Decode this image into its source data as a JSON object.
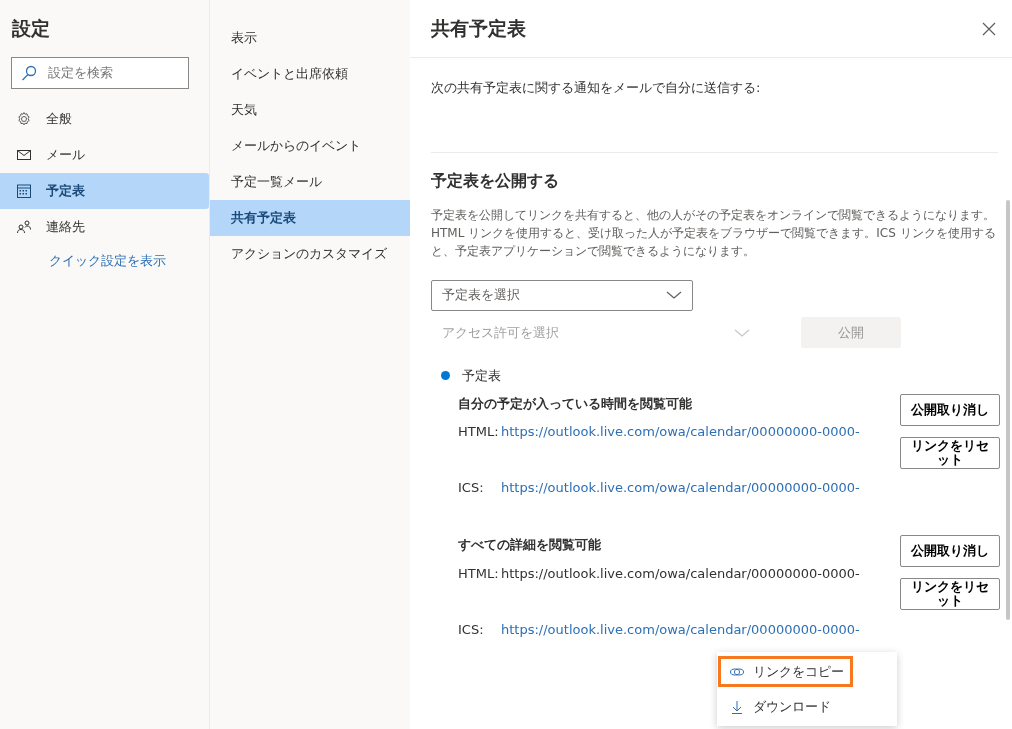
{
  "sidebar": {
    "title": "設定",
    "search": {
      "placeholder": "設定を検索"
    },
    "items": [
      {
        "label": "全般",
        "selected": false
      },
      {
        "label": "メール",
        "selected": false
      },
      {
        "label": "予定表",
        "selected": true
      },
      {
        "label": "連絡先",
        "selected": false
      }
    ],
    "quick_link": "クイック設定を表示"
  },
  "subnav": {
    "items": [
      {
        "label": "表示",
        "selected": false
      },
      {
        "label": "イベントと出席依頼",
        "selected": false
      },
      {
        "label": "天気",
        "selected": false
      },
      {
        "label": "メールからのイベント",
        "selected": false
      },
      {
        "label": "予定一覧メール",
        "selected": false
      },
      {
        "label": "共有予定表",
        "selected": true
      },
      {
        "label": "アクションのカスタマイズ",
        "selected": false
      }
    ]
  },
  "panel": {
    "title": "共有予定表",
    "notify_text": "次の共有予定表に関する通知をメールで自分に送信する:",
    "publish": {
      "heading": "予定表を公開する",
      "description": "予定表を公開してリンクを共有すると、他の人がその予定表をオンラインで閲覧できるようになります。HTML リンクを使用すると、受け取った人が予定表をブラウザーで閲覧できます。ICS リンクを使用すると、予定表アプリケーションで閲覧できるようになります。",
      "calendar_select": {
        "placeholder": "予定表を選択",
        "disabled": false
      },
      "permission_select": {
        "placeholder": "アクセス許可を選択",
        "disabled": true
      },
      "publish_button": {
        "label": "公開",
        "disabled": true
      },
      "calendar": {
        "name": "予定表",
        "color": "#0078d4",
        "permissions": [
          {
            "title": "自分の予定が入っている時間を閲覧可能",
            "buttons": [
              "公開取り消し",
              "リンクをリセット"
            ],
            "links": [
              {
                "label": "HTML:",
                "url": "https://outlook.live.com/owa/calendar/00000000-0000-",
                "visited": false
              },
              {
                "label": "ICS:",
                "url": "https://outlook.live.com/owa/calendar/00000000-0000-",
                "visited": false
              }
            ]
          },
          {
            "title": "すべての詳細を閲覧可能",
            "buttons": [
              "公開取り消し",
              "リンクをリセット"
            ],
            "links": [
              {
                "label": "HTML:",
                "url": "https://outlook.live.com/owa/calendar/00000000-0000-",
                "visited": true
              },
              {
                "label": "ICS:",
                "url": "https://outlook.live.com/owa/calendar/00000000-0000-",
                "visited": false
              }
            ]
          }
        ]
      }
    }
  },
  "context_menu": [
    {
      "label": "リンクをコピー",
      "focused": true
    },
    {
      "label": "ダウンロード",
      "focused": false
    }
  ]
}
